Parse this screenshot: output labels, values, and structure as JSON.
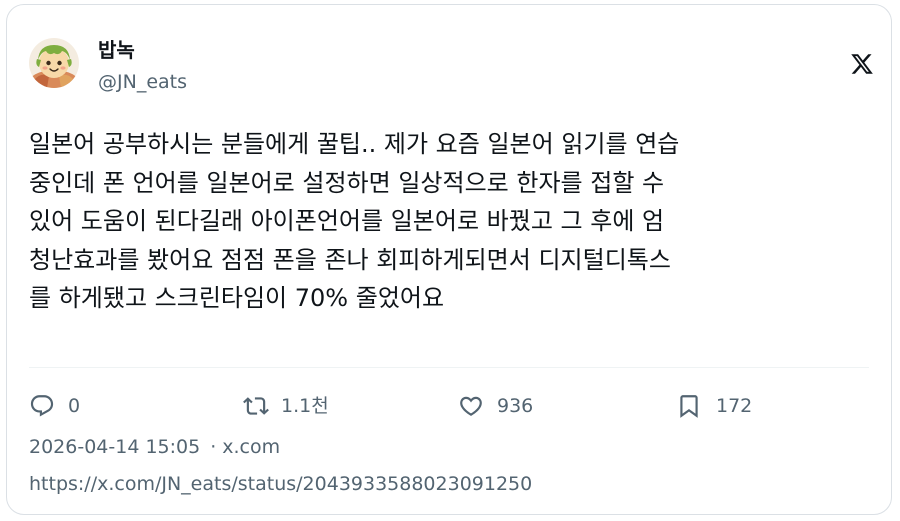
{
  "author": {
    "display_name": "밥녹",
    "handle": "@JN_eats",
    "avatar_icon": "cartoon-face-avatar"
  },
  "brand": {
    "logo_icon": "x-logo-icon"
  },
  "tweet": {
    "text": "일본어 공부하시는 분들에게 꿀팁.. 제가 요즘 일본어 읽기를 연습\n중인데 폰 언어를 일본어로 설정하면 일상적으로 한자를 접할 수\n있어 도움이 된다길래 아이폰언어를 일본어로 바꿨고 그 후에 엄\n청난효과를 봤어요 점점 폰을 존나 회피하게되면서 디지털디톡스\n를 하게됐고 스크린타임이 70% 줄었어요"
  },
  "actions": {
    "reply": {
      "icon": "reply-icon",
      "count": "0"
    },
    "retweet": {
      "icon": "retweet-icon",
      "count": "1.1천"
    },
    "like": {
      "icon": "heart-icon",
      "count": "936"
    },
    "bookmark": {
      "icon": "bookmark-icon",
      "count": "172"
    }
  },
  "meta": {
    "timestamp": "2026-04-14 15:05",
    "separator": "·",
    "source": "x.com"
  },
  "url": "https://x.com/JN_eats/status/2043933588023091250",
  "colors": {
    "text_primary": "#0f1419",
    "text_secondary": "#536471",
    "border": "#dbe0e5"
  }
}
